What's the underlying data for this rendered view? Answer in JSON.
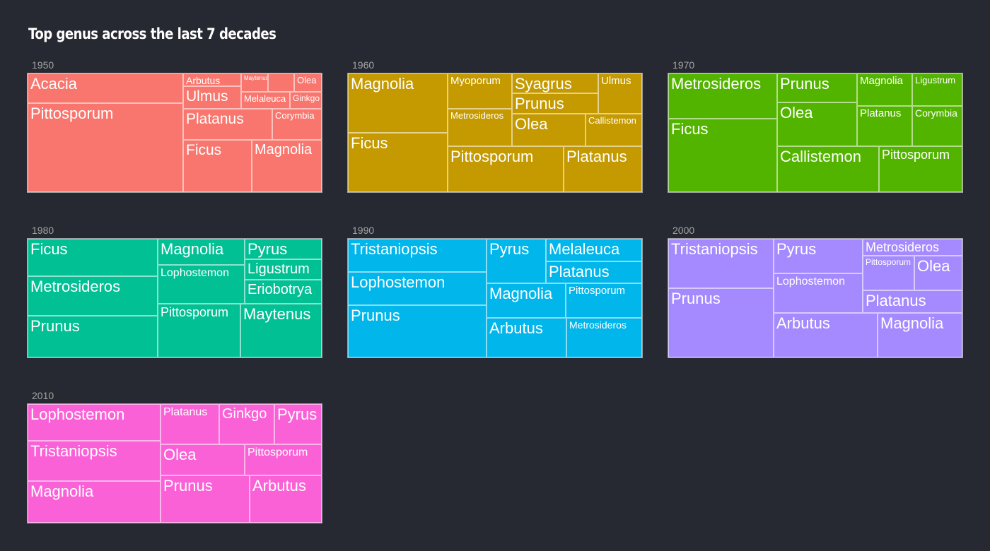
{
  "chart_data": {
    "type": "treemap",
    "title": "Top genus across the last 7 decades",
    "panels": [
      {
        "label": "1950",
        "color": "#F8766D",
        "tiles": [
          {
            "name": "Acacia",
            "value": 20
          },
          {
            "name": "Pittosporum",
            "value": 35
          },
          {
            "name": "Arbutus",
            "value": 2
          },
          {
            "name": "Maytenus",
            "value": 1
          },
          {
            "name": "",
            "value": 1
          },
          {
            "name": "Olea",
            "value": 1.5
          },
          {
            "name": "Ulmus",
            "value": 3
          },
          {
            "name": "Melaleuca",
            "value": 1.5
          },
          {
            "name": "Ginkgo",
            "value": 1.5
          },
          {
            "name": "Platanus",
            "value": 6
          },
          {
            "name": "Corymbia",
            "value": 4
          },
          {
            "name": "Ficus",
            "value": 7
          },
          {
            "name": "Magnolia",
            "value": 7
          }
        ]
      },
      {
        "label": "1960",
        "color": "#C49A00",
        "tiles": [
          {
            "name": "Magnolia",
            "value": 15
          },
          {
            "name": "Ficus",
            "value": 15
          },
          {
            "name": "Myoporum",
            "value": 6
          },
          {
            "name": "Metrosideros",
            "value": 6
          },
          {
            "name": "Syagrus",
            "value": 3.5
          },
          {
            "name": "Prunus",
            "value": 3.5
          },
          {
            "name": "Ulmus",
            "value": 3.5
          },
          {
            "name": "Olea",
            "value": 5
          },
          {
            "name": "Callistemon",
            "value": 3
          },
          {
            "name": "Pittosporum",
            "value": 12
          },
          {
            "name": "Platanus",
            "value": 7.5
          }
        ]
      },
      {
        "label": "1970",
        "color": "#53B400",
        "tiles": [
          {
            "name": "Metrosideros",
            "value": 12
          },
          {
            "name": "Ficus",
            "value": 18
          },
          {
            "name": "Prunus",
            "value": 6
          },
          {
            "name": "Olea",
            "value": 9
          },
          {
            "name": "Magnolia",
            "value": 3.5
          },
          {
            "name": "Ligustrum",
            "value": 3
          },
          {
            "name": "Platanus",
            "value": 5
          },
          {
            "name": "Corymbia",
            "value": 4.5
          },
          {
            "name": "Callistemon",
            "value": 11
          },
          {
            "name": "Pittosporum",
            "value": 9
          }
        ]
      },
      {
        "label": "1980",
        "color": "#00C094",
        "tiles": [
          {
            "name": "Ficus",
            "value": 12
          },
          {
            "name": "Metrosideros",
            "value": 12
          },
          {
            "name": "Prunus",
            "value": 12
          },
          {
            "name": "Magnolia",
            "value": 4.5
          },
          {
            "name": "Lophostemon",
            "value": 8
          },
          {
            "name": "Pyrus",
            "value": 3.5
          },
          {
            "name": "Ligustrum",
            "value": 3
          },
          {
            "name": "Eriobotrya",
            "value": 3.5
          },
          {
            "name": "Pittosporum",
            "value": 12
          },
          {
            "name": "Maytenus",
            "value": 12
          }
        ]
      },
      {
        "label": "1990",
        "color": "#00B6EB",
        "tiles": [
          {
            "name": "Tristaniopsis",
            "value": 11
          },
          {
            "name": "Lophostemon",
            "value": 11
          },
          {
            "name": "Prunus",
            "value": 18
          },
          {
            "name": "Pyrus",
            "value": 7
          },
          {
            "name": "Melaleuca",
            "value": 4
          },
          {
            "name": "Platanus",
            "value": 4
          },
          {
            "name": "Magnolia",
            "value": 7
          },
          {
            "name": "Pittosporum",
            "value": 7
          },
          {
            "name": "Arbutus",
            "value": 8
          },
          {
            "name": "Metrosideros",
            "value": 7
          }
        ]
      },
      {
        "label": "2000",
        "color": "#A58AFF",
        "tiles": [
          {
            "name": "Tristaniopsis",
            "value": 14
          },
          {
            "name": "Prunus",
            "value": 20
          },
          {
            "name": "Pyrus",
            "value": 6
          },
          {
            "name": "Lophostemon",
            "value": 8
          },
          {
            "name": "Metrosideros",
            "value": 3
          },
          {
            "name": "Pittosporum",
            "value": 3
          },
          {
            "name": "Olea",
            "value": 3
          },
          {
            "name": "Platanus",
            "value": 5
          },
          {
            "name": "Arbutus",
            "value": 10
          },
          {
            "name": "Magnolia",
            "value": 8
          }
        ]
      },
      {
        "label": "2010",
        "color": "#FB61D7",
        "tiles": [
          {
            "name": "Lophostemon",
            "value": 13
          },
          {
            "name": "Tristaniopsis",
            "value": 15
          },
          {
            "name": "Magnolia",
            "value": 16
          },
          {
            "name": "Platanus",
            "value": 5
          },
          {
            "name": "Ginkgo",
            "value": 5
          },
          {
            "name": "Pyrus",
            "value": 4
          },
          {
            "name": "Olea",
            "value": 7
          },
          {
            "name": "Pittosporum",
            "value": 6
          },
          {
            "name": "Prunus",
            "value": 9
          },
          {
            "name": "Arbutus",
            "value": 8
          }
        ]
      }
    ]
  }
}
